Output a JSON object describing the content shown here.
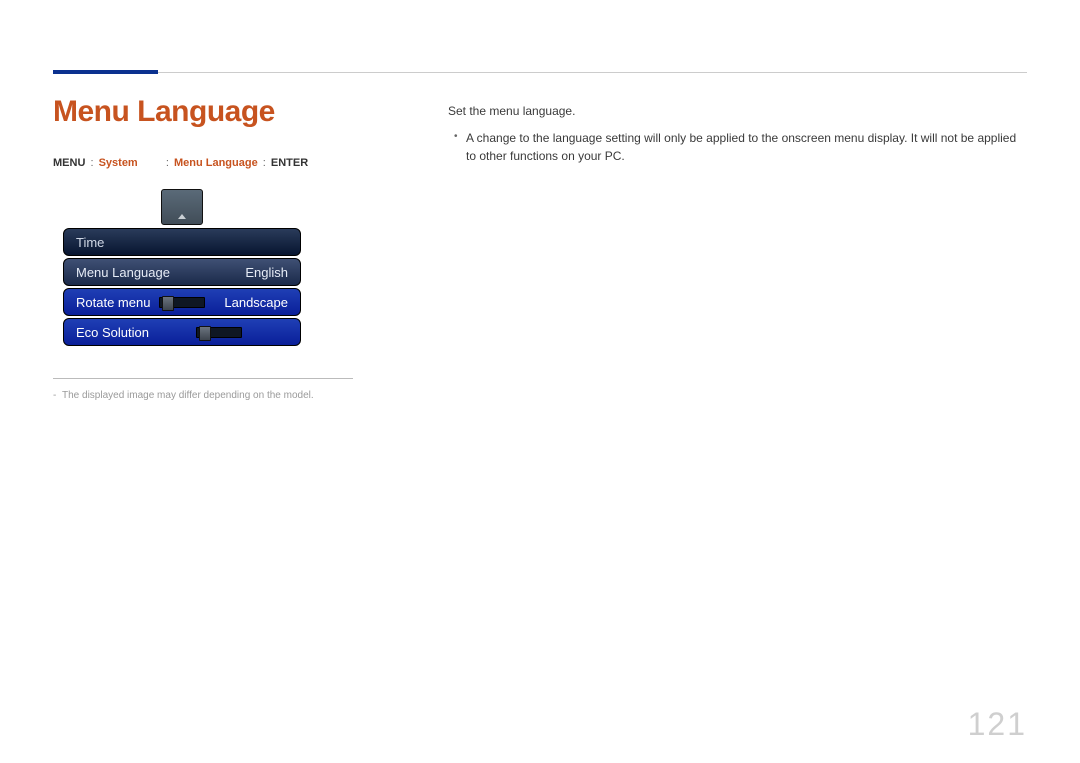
{
  "header": {
    "title": "Menu Language",
    "breadcrumb": {
      "part1": "MENU",
      "sep1": ": ",
      "part2": "System",
      "sep2": ": ",
      "part3": "Menu Language",
      "sep3": ": ",
      "part4": "ENTER"
    }
  },
  "osd": {
    "rows": [
      {
        "label": "Time",
        "value": ""
      },
      {
        "label": "Menu Language",
        "value": "English"
      },
      {
        "label": "Rotate menu",
        "value": "Landscape"
      },
      {
        "label": "Eco Solution",
        "value": ""
      }
    ]
  },
  "footnote": "The displayed image may differ depending on the model.",
  "body": {
    "lead": "Set the menu language.",
    "bullets": [
      "A change to the language setting will only be applied to the onscreen menu display. It will not be applied to other functions on your PC."
    ]
  },
  "page_number": "121"
}
